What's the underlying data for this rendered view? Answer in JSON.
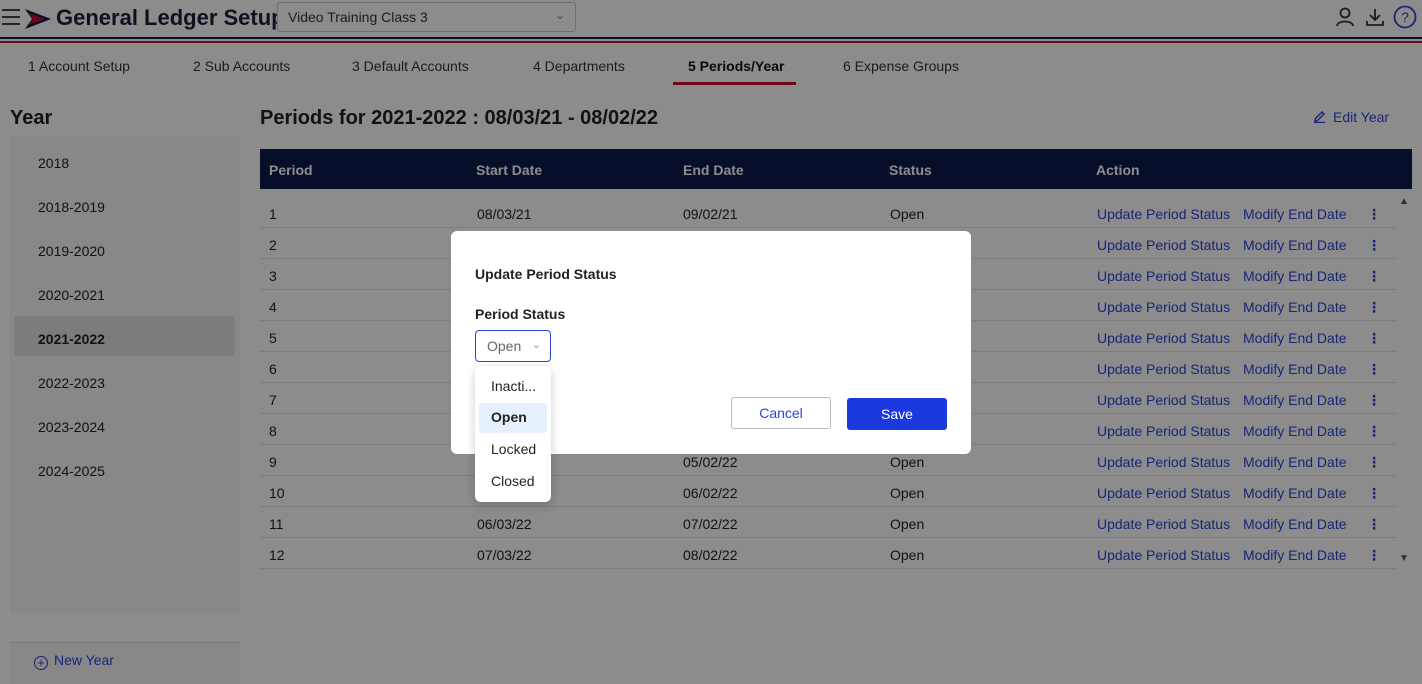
{
  "header": {
    "app_title": "General Ledger Setup",
    "company_select": "Video Training Class 3"
  },
  "tabs": [
    {
      "label": "1 Account Setup"
    },
    {
      "label": "2 Sub Accounts"
    },
    {
      "label": "3 Default Accounts"
    },
    {
      "label": "4 Departments"
    },
    {
      "label": "5 Periods/Year",
      "active": true
    },
    {
      "label": "6 Expense Groups"
    }
  ],
  "sidebar": {
    "heading": "Year",
    "years": [
      "2018",
      "2018-2019",
      "2019-2020",
      "2020-2021",
      "2021-2022",
      "2022-2023",
      "2023-2024",
      "2024-2025"
    ],
    "selected_year": "2021-2022",
    "new_year_label": "New Year"
  },
  "main": {
    "title": "Periods for 2021-2022 : 08/03/21 - 08/02/22",
    "edit_year_label": "Edit Year",
    "columns": [
      "Period",
      "Start Date",
      "End Date",
      "Status",
      "Action"
    ],
    "action_update": "Update Period Status",
    "action_modify": "Modify End Date",
    "rows": [
      {
        "period": "1",
        "start": "08/03/21",
        "end": "09/02/21",
        "status": "Open"
      },
      {
        "period": "2",
        "start": "",
        "end": "",
        "status": ""
      },
      {
        "period": "3",
        "start": "",
        "end": "",
        "status": ""
      },
      {
        "period": "4",
        "start": "",
        "end": "",
        "status": ""
      },
      {
        "period": "5",
        "start": "",
        "end": "",
        "status": ""
      },
      {
        "period": "6",
        "start": "",
        "end": "",
        "status": ""
      },
      {
        "period": "7",
        "start": "",
        "end": "",
        "status": ""
      },
      {
        "period": "8",
        "start": "",
        "end": "",
        "status": ""
      },
      {
        "period": "9",
        "start": "",
        "end": "05/02/22",
        "status": "Open"
      },
      {
        "period": "10",
        "start": "",
        "end": "06/02/22",
        "status": "Open"
      },
      {
        "period": "11",
        "start": "06/03/22",
        "end": "07/02/22",
        "status": "Open"
      },
      {
        "period": "12",
        "start": "07/03/22",
        "end": "08/02/22",
        "status": "Open"
      }
    ]
  },
  "modal": {
    "title": "Update Period Status",
    "field_label": "Period Status",
    "selected_value": "Open",
    "options": [
      "Inacti...",
      "Open",
      "Locked",
      "Closed"
    ],
    "cancel_label": "Cancel",
    "save_label": "Save"
  },
  "colors": {
    "navy": "#0d1b4e",
    "brand_red": "#c8102e",
    "link_blue": "#2a45d8",
    "save_blue": "#1a3ae0"
  }
}
